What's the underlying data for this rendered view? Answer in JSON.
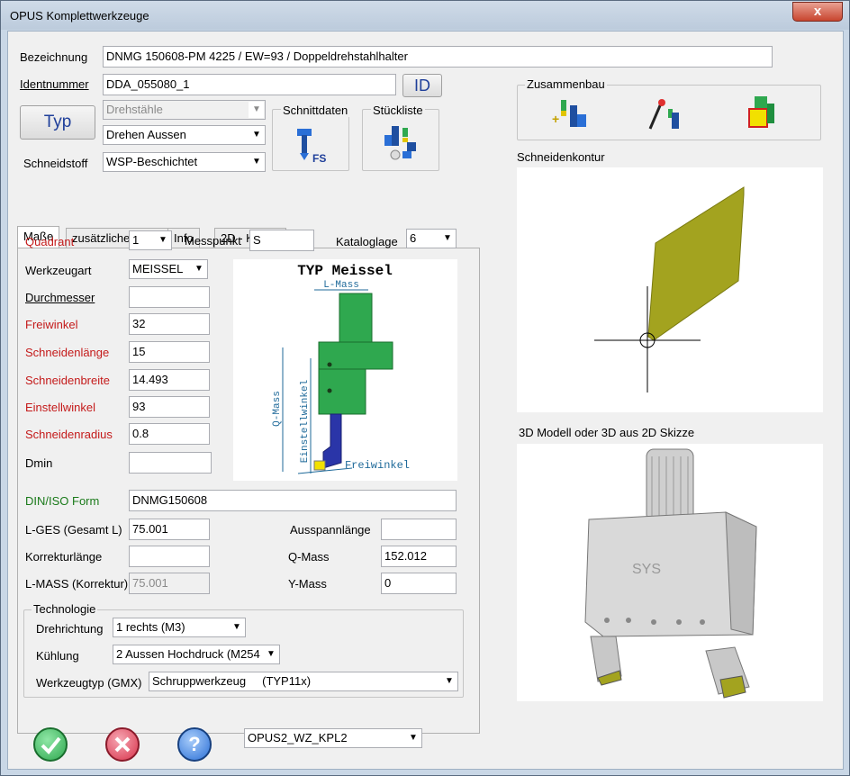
{
  "window": {
    "title": "OPUS Komplettwerkzeuge",
    "close_glyph": "x"
  },
  "header": {
    "bezeichnung_label": "Bezeichnung",
    "bezeichnung_value": "DNMG 150608-PM 4225 / EW=93 / Doppeldrehstahlhalter",
    "identnummer_label": "Identnummer",
    "identnummer_value": "DDA_055080_1",
    "id_button": "ID",
    "typ_button": "Typ",
    "type_select_1": "Drehstähle",
    "type_select_2": "Drehen Aussen",
    "schneidstoff_label": "Schneidstoff",
    "schneidstoff_value": "WSP-Beschichtet",
    "schnittdaten_label": "Schnittdaten",
    "stueckliste_label": "Stückliste",
    "fs_text": "FS"
  },
  "tabs": [
    "Maße",
    "zusätzliche Maße",
    "Info",
    "2D - Kontur"
  ],
  "masse": {
    "quadrant_label": "Quadrant",
    "quadrant_value": "1",
    "messpunkt_label": "Messpunkt",
    "messpunkt_value": "S",
    "kataloglage_label": "Kataloglage",
    "kataloglage_value": "6",
    "werkzeugart_label": "Werkzeugart",
    "werkzeugart_value": "MEISSEL",
    "durchmesser_label": "Durchmesser",
    "durchmesser_value": "",
    "freiwinkel_label": "Freiwinkel",
    "freiwinkel_value": "32",
    "schneidenlaenge_label": "Schneidenlänge",
    "schneidenlaenge_value": "15",
    "schneidenbreite_label": "Schneidenbreite",
    "schneidenbreite_value": "14.493",
    "einstellwinkel_label": "Einstellwinkel",
    "einstellwinkel_value": "93",
    "schneidenradius_label": "Schneidenradius",
    "schneidenradius_value": "0.8",
    "dmin_label": "Dmin",
    "dmin_value": "",
    "diniso_label": "DIN/ISO Form",
    "diniso_value": "DNMG150608",
    "lges_label": "L-GES (Gesamt L)",
    "lges_value": "75.001",
    "korrektur_label": "Korrekturlänge",
    "korrektur_value": "",
    "lmass_label": "L-MASS (Korrektur)",
    "lmass_value": "75.001",
    "ausspann_label": "Ausspannlänge",
    "ausspann_value": "",
    "qmass_label": "Q-Mass",
    "qmass_value": "152.012",
    "ymass_label": "Y-Mass",
    "ymass_value": "0"
  },
  "diagram": {
    "title": "TYP Meissel",
    "l_mass": "L-Mass",
    "q_mass": "Q-Mass",
    "einstellwinkel": "Einstellwinkel",
    "freiwinkel": "Freiwinkel"
  },
  "technologie": {
    "caption": "Technologie",
    "drehrichtung_label": "Drehrichtung",
    "drehrichtung_value": "1 rechts (M3)",
    "kuehlung_label": "Kühlung",
    "kuehlung_value": "2 Aussen Hochdruck (M254",
    "werkzeugtyp_label": "Werkzeugtyp (GMX)",
    "werkzeugtyp_value": "Schruppwerkzeug     (TYP11x)"
  },
  "right": {
    "zusammenbau_label": "Zusammenbau",
    "schneidenkontur_label": "Schneidenkontur",
    "modell_label": "3D Modell oder 3D aus 2D Skizze",
    "holder_text": "SYS"
  },
  "footer": {
    "profile_value": "OPUS2_WZ_KPL2",
    "help_glyph": "?"
  },
  "colors": {
    "accent_green": "#2fa84f",
    "cancel_red": "#d8324a",
    "help_blue": "#2a6fd6",
    "insert_olive": "#a3a31f"
  }
}
